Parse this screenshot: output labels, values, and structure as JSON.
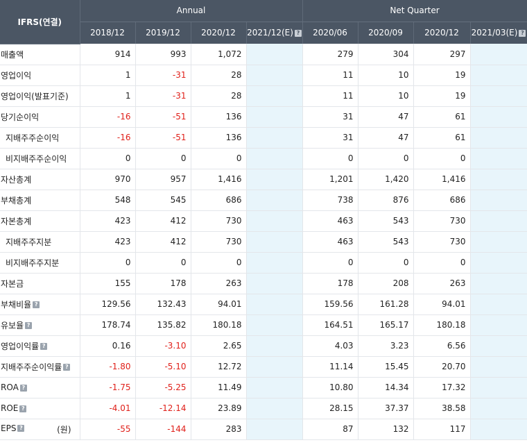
{
  "header": {
    "corner": "IFRS(연결)",
    "annual": "Annual",
    "quarter": "Net Quarter",
    "periods": [
      "2018/12",
      "2019/12",
      "2020/12",
      "2021/12(E)",
      "2020/06",
      "2020/09",
      "2020/12",
      "2021/03(E)"
    ]
  },
  "rows": [
    {
      "label": "매출액",
      "sub": false,
      "help": false,
      "unit": "",
      "v": [
        "914",
        "993",
        "1,072",
        "",
        "279",
        "304",
        "297",
        ""
      ]
    },
    {
      "label": "영업이익",
      "sub": false,
      "help": false,
      "unit": "",
      "v": [
        "1",
        "-31",
        "28",
        "",
        "11",
        "10",
        "19",
        ""
      ]
    },
    {
      "label": "영업이익(발표기준)",
      "sub": false,
      "help": false,
      "unit": "",
      "v": [
        "1",
        "-31",
        "28",
        "",
        "11",
        "10",
        "19",
        ""
      ]
    },
    {
      "label": "당기순이익",
      "sub": false,
      "help": false,
      "unit": "",
      "v": [
        "-16",
        "-51",
        "136",
        "",
        "31",
        "47",
        "61",
        ""
      ]
    },
    {
      "label": "지배주주순이익",
      "sub": true,
      "help": false,
      "unit": "",
      "v": [
        "-16",
        "-51",
        "136",
        "",
        "31",
        "47",
        "61",
        ""
      ]
    },
    {
      "label": "비지배주주순이익",
      "sub": true,
      "help": false,
      "unit": "",
      "v": [
        "0",
        "0",
        "0",
        "",
        "0",
        "0",
        "0",
        ""
      ]
    },
    {
      "label": "자산총계",
      "sub": false,
      "help": false,
      "unit": "",
      "v": [
        "970",
        "957",
        "1,416",
        "",
        "1,201",
        "1,420",
        "1,416",
        ""
      ]
    },
    {
      "label": "부채총계",
      "sub": false,
      "help": false,
      "unit": "",
      "v": [
        "548",
        "545",
        "686",
        "",
        "738",
        "876",
        "686",
        ""
      ]
    },
    {
      "label": "자본총계",
      "sub": false,
      "help": false,
      "unit": "",
      "v": [
        "423",
        "412",
        "730",
        "",
        "463",
        "543",
        "730",
        ""
      ]
    },
    {
      "label": "지배주주지분",
      "sub": true,
      "help": false,
      "unit": "",
      "v": [
        "423",
        "412",
        "730",
        "",
        "463",
        "543",
        "730",
        ""
      ]
    },
    {
      "label": "비지배주주지분",
      "sub": true,
      "help": false,
      "unit": "",
      "v": [
        "0",
        "0",
        "0",
        "",
        "0",
        "0",
        "0",
        ""
      ]
    },
    {
      "label": "자본금",
      "sub": false,
      "help": false,
      "unit": "",
      "v": [
        "155",
        "178",
        "263",
        "",
        "178",
        "208",
        "263",
        ""
      ]
    },
    {
      "label": "부채비율",
      "sub": false,
      "help": true,
      "unit": "",
      "v": [
        "129.56",
        "132.43",
        "94.01",
        "",
        "159.56",
        "161.28",
        "94.01",
        ""
      ]
    },
    {
      "label": "유보율",
      "sub": false,
      "help": true,
      "unit": "",
      "v": [
        "178.74",
        "135.82",
        "180.18",
        "",
        "164.51",
        "165.17",
        "180.18",
        ""
      ]
    },
    {
      "label": "영업이익률",
      "sub": false,
      "help": true,
      "unit": "",
      "v": [
        "0.16",
        "-3.10",
        "2.65",
        "",
        "4.03",
        "3.23",
        "6.56",
        ""
      ]
    },
    {
      "label": "지배주주순이익률",
      "sub": false,
      "help": true,
      "unit": "",
      "v": [
        "-1.80",
        "-5.10",
        "12.72",
        "",
        "11.14",
        "15.45",
        "20.70",
        ""
      ]
    },
    {
      "label": "ROA",
      "sub": false,
      "help": true,
      "unit": "",
      "v": [
        "-1.75",
        "-5.25",
        "11.49",
        "",
        "10.80",
        "14.34",
        "17.32",
        ""
      ]
    },
    {
      "label": "ROE",
      "sub": false,
      "help": true,
      "unit": "",
      "v": [
        "-4.01",
        "-12.14",
        "23.89",
        "",
        "28.15",
        "37.37",
        "38.58",
        ""
      ]
    },
    {
      "label": "EPS",
      "sub": false,
      "help": true,
      "unit": "(원)",
      "v": [
        "-55",
        "-144",
        "283",
        "",
        "87",
        "132",
        "117",
        ""
      ]
    }
  ]
}
